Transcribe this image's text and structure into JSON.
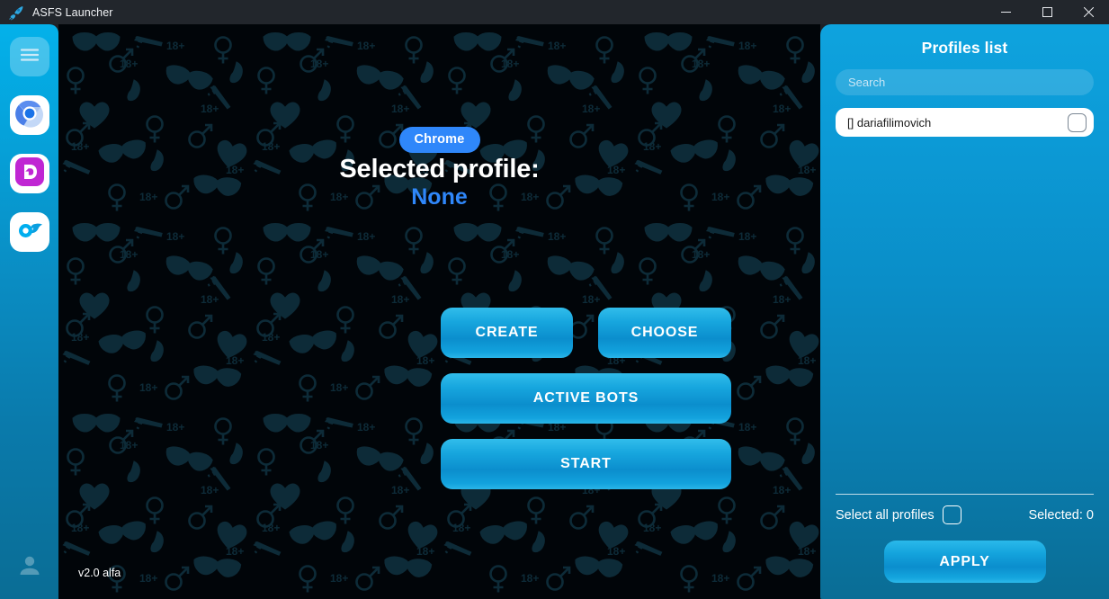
{
  "window": {
    "title": "ASFS Launcher",
    "icon": "app-logo-icon",
    "controls": {
      "minimize": "minimize-icon",
      "maximize": "maximize-icon",
      "close": "close-icon"
    }
  },
  "sidebar": {
    "items": [
      {
        "name": "menu-button",
        "icon": "hamburger-menu-icon"
      },
      {
        "name": "chromium-button",
        "icon": "chromium-browser-icon"
      },
      {
        "name": "dolphin-button",
        "icon": "dolphin-anty-icon"
      },
      {
        "name": "onlyfans-button",
        "icon": "onlyfans-icon"
      }
    ],
    "account": {
      "name": "account-avatar",
      "icon": "user-avatar-icon"
    }
  },
  "main": {
    "browser_badge": "Chrome",
    "selected_profile_label": "Selected profile:",
    "selected_profile_value": "None",
    "buttons": {
      "create": "CREATE",
      "choose": "CHOOSE",
      "active_bots": "ACTIVE BOTS",
      "start": "START"
    },
    "version": "v2.0 alfa"
  },
  "panel": {
    "title": "Profiles list",
    "search": {
      "value": "",
      "placeholder": "Search"
    },
    "profiles": [
      {
        "name": "[] dariafilimovich",
        "checked": false
      }
    ],
    "select_all_label": "Select all profiles",
    "select_all_checked": false,
    "selected_count_text": "Selected: 0",
    "apply_label": "APPLY"
  },
  "colors": {
    "accent_blue": "#0a8ecd",
    "badge_blue": "#2f87fa",
    "sidebar_top": "#04b1ea",
    "sidebar_bottom": "#0a6d95",
    "panel_top": "#0ea3de",
    "panel_bottom": "#0a6d95",
    "stage_background": "#010509",
    "pattern_icon": "#0d2b38",
    "titlebar": "#22262c"
  }
}
